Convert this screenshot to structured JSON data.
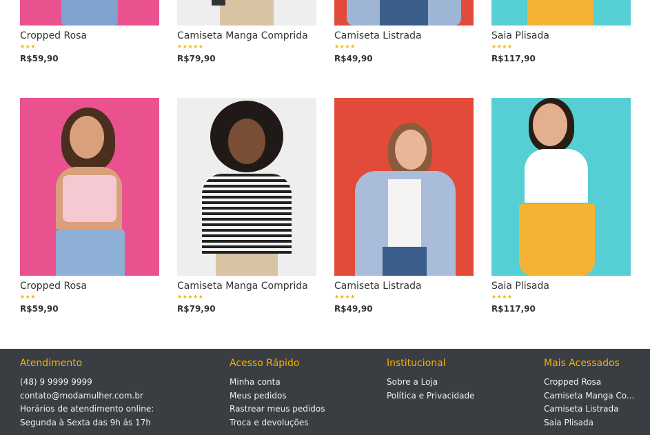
{
  "products_row1": [
    {
      "name": "Cropped Rosa",
      "rating_stars": "★★★",
      "rating": 3,
      "price": "R$59,90",
      "photo_color": "#e9518f"
    },
    {
      "name": "Camiseta Manga Comprida",
      "rating_stars": "★★★★★",
      "rating": 5,
      "price": "R$79,90",
      "photo_color": "#eeeeee"
    },
    {
      "name": "Camiseta Listrada",
      "rating_stars": "★★★★",
      "rating": 4,
      "price": "R$49,90",
      "photo_color": "#e24a3a"
    },
    {
      "name": "Saia Plisada",
      "rating_stars": "★★★★",
      "rating": 4,
      "price": "R$117,90",
      "photo_color": "#55cfd3"
    }
  ],
  "products_row2": [
    {
      "name": "Cropped Rosa",
      "rating_stars": "★★★",
      "rating": 3,
      "price": "R$59,90",
      "photo_color": "#e9518f"
    },
    {
      "name": "Camiseta Manga Comprida",
      "rating_stars": "★★★★★",
      "rating": 5,
      "price": "R$79,90",
      "photo_color": "#eeeeee"
    },
    {
      "name": "Camiseta Listrada",
      "rating_stars": "★★★★",
      "rating": 4,
      "price": "R$49,90",
      "photo_color": "#e24a3a"
    },
    {
      "name": "Saia Plisada",
      "rating_stars": "★★★★",
      "rating": 4,
      "price": "R$117,90",
      "photo_color": "#55cfd3"
    }
  ],
  "footer": {
    "atendimento": {
      "title": "Atendimento",
      "items": [
        "(48) 9 9999 9999",
        "contato@modamulher.com.br",
        "Horários de atendimento online:",
        "Segunda à Sexta das 9h ás 17h"
      ]
    },
    "acesso_rapido": {
      "title": "Acesso Rápido",
      "items": [
        "Minha conta",
        "Meus pedidos",
        "Rastrear meus pedidos",
        "Troca e devoluções"
      ]
    },
    "institucional": {
      "title": "Institucional",
      "items": [
        "Sobre a Loja",
        "Política e Privacidade"
      ]
    },
    "mais_acessados": {
      "title": "Mais Acessados",
      "items": [
        "Cropped Rosa",
        "Camiseta Manga Co...",
        "Camiseta Listrada",
        "Saia Plisada"
      ]
    }
  },
  "colors": {
    "accent": "#f5b400",
    "footer_bg": "#3a3d42",
    "text": "#333333"
  }
}
